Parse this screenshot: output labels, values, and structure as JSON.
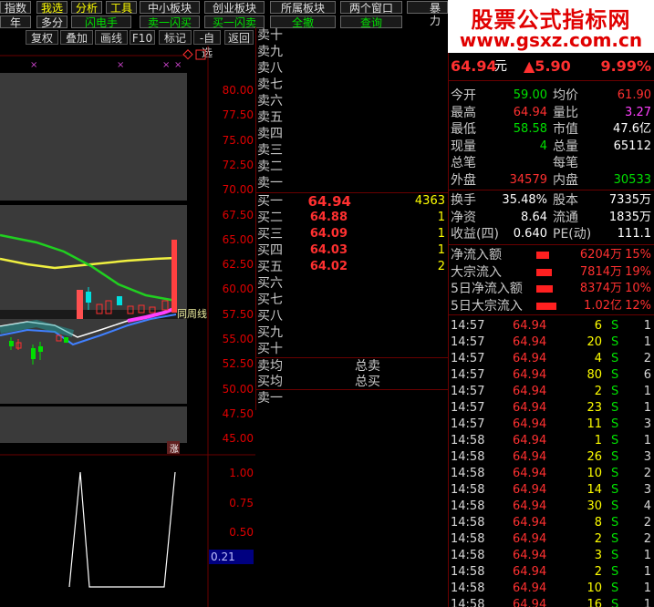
{
  "menu_top": [
    {
      "label": "指数",
      "style": "normal"
    },
    {
      "label": "我选",
      "style": "sel"
    },
    {
      "label": "分析",
      "style": "sel"
    },
    {
      "label": "工具",
      "style": "sel"
    },
    {
      "label": "中小板块",
      "style": "normal"
    },
    {
      "label": "创业板块",
      "style": "normal"
    },
    {
      "label": "所属板块",
      "style": "normal"
    },
    {
      "label": "两个窗口",
      "style": "normal"
    },
    {
      "label": "暴力",
      "style": "normal"
    }
  ],
  "menu_second": [
    {
      "label": "年",
      "style": "normal"
    },
    {
      "label": "多分",
      "style": "normal"
    },
    {
      "label": "闪电手",
      "style": "green"
    },
    {
      "label": "卖一闪买",
      "style": "green"
    },
    {
      "label": "买一闪卖",
      "style": "green"
    },
    {
      "label": "全撤",
      "style": "green"
    },
    {
      "label": "查询",
      "style": "green"
    }
  ],
  "toolbar": [
    "复权",
    "叠加",
    "画线",
    "F10",
    "标记",
    "-自选",
    "返回"
  ],
  "watermark": {
    "line1": "股票公式指标网",
    "line2": "www.gsxz.com.cn"
  },
  "chart": {
    "y_ticks": [
      "80.00",
      "77.50",
      "75.00",
      "72.50",
      "70.00",
      "67.50",
      "65.00",
      "62.50",
      "60.00",
      "57.50",
      "55.00",
      "52.50",
      "50.00",
      "47.50",
      "45.00"
    ],
    "annotation": "同周线",
    "marker_label": "涨",
    "indicator_ticks": [
      "1.00",
      "0.75",
      "0.50"
    ],
    "indicator_value": "0.21"
  },
  "orderbook": {
    "sell_labels": [
      "卖十",
      "卖九",
      "卖八",
      "卖七",
      "卖六",
      "卖五",
      "卖四",
      "卖三",
      "卖二",
      "卖一"
    ],
    "buy": [
      {
        "label": "买一",
        "price": "64.94",
        "vol": "4363"
      },
      {
        "label": "买二",
        "price": "64.88",
        "vol": "1"
      },
      {
        "label": "买三",
        "price": "64.09",
        "vol": "1"
      },
      {
        "label": "买四",
        "price": "64.03",
        "vol": "1"
      },
      {
        "label": "买五",
        "price": "64.02",
        "vol": "2"
      },
      {
        "label": "买六",
        "price": "",
        "vol": ""
      },
      {
        "label": "买七",
        "price": "",
        "vol": ""
      },
      {
        "label": "买八",
        "price": "",
        "vol": ""
      },
      {
        "label": "买九",
        "price": "",
        "vol": ""
      },
      {
        "label": "买十",
        "price": "",
        "vol": ""
      }
    ],
    "sell_avg": "卖均",
    "buy_avg": "买均",
    "total_sell": "总卖",
    "total_buy": "总买",
    "bottom_label": "卖一"
  },
  "quote": {
    "price": "64.94",
    "unit": "元",
    "change": "▲5.90",
    "pct": "9.99%",
    "rows": [
      {
        "l1": "今开",
        "v1": "59.00",
        "c1": "green",
        "l2": "均价",
        "v2": "61.90",
        "c2": "red"
      },
      {
        "l1": "最高",
        "v1": "64.94",
        "c1": "red",
        "l2": "量比",
        "v2": "3.27",
        "c2": "magenta"
      },
      {
        "l1": "最低",
        "v1": "58.58",
        "c1": "green",
        "l2": "市值",
        "v2": "47.6亿",
        "c2": "white"
      },
      {
        "l1": "现量",
        "v1": "4",
        "c1": "green",
        "l2": "总量",
        "v2": "65112",
        "c2": "white"
      },
      {
        "l1": "总笔",
        "v1": "",
        "c1": "white",
        "l2": "每笔",
        "v2": "",
        "c2": "white"
      },
      {
        "l1": "外盘",
        "v1": "34579",
        "c1": "red",
        "l2": "内盘",
        "v2": "30533",
        "c2": "green"
      }
    ],
    "rows2": [
      {
        "l1": "换手",
        "v1": "35.48%",
        "l2": "股本",
        "v2": "7335万"
      },
      {
        "l1": "净资",
        "v1": "8.64",
        "l2": "流通",
        "v2": "1835万"
      },
      {
        "l1": "收益(四)",
        "v1": "0.640",
        "l2": "PE(动)",
        "v2": "111.1"
      }
    ],
    "flows": [
      {
        "label": "净流入额",
        "value": "6204万",
        "pct": "15%"
      },
      {
        "label": "大宗流入",
        "value": "7814万",
        "pct": "19%"
      },
      {
        "label": "5日净流入额",
        "value": "8374万",
        "pct": "10%"
      },
      {
        "label": "5日大宗流入",
        "value": "1.02亿",
        "pct": "12%"
      }
    ]
  },
  "trades": [
    {
      "time": "14:57",
      "price": "64.94",
      "vol": "6",
      "side": "S",
      "n": "1"
    },
    {
      "time": "14:57",
      "price": "64.94",
      "vol": "20",
      "side": "S",
      "n": "1"
    },
    {
      "time": "14:57",
      "price": "64.94",
      "vol": "4",
      "side": "S",
      "n": "2"
    },
    {
      "time": "14:57",
      "price": "64.94",
      "vol": "80",
      "side": "S",
      "n": "6"
    },
    {
      "time": "14:57",
      "price": "64.94",
      "vol": "2",
      "side": "S",
      "n": "1"
    },
    {
      "time": "14:57",
      "price": "64.94",
      "vol": "23",
      "side": "S",
      "n": "1"
    },
    {
      "time": "14:57",
      "price": "64.94",
      "vol": "11",
      "side": "S",
      "n": "3"
    },
    {
      "time": "14:58",
      "price": "64.94",
      "vol": "1",
      "side": "S",
      "n": "1"
    },
    {
      "time": "14:58",
      "price": "64.94",
      "vol": "26",
      "side": "S",
      "n": "3"
    },
    {
      "time": "14:58",
      "price": "64.94",
      "vol": "10",
      "side": "S",
      "n": "2"
    },
    {
      "time": "14:58",
      "price": "64.94",
      "vol": "14",
      "side": "S",
      "n": "3"
    },
    {
      "time": "14:58",
      "price": "64.94",
      "vol": "30",
      "side": "S",
      "n": "4"
    },
    {
      "time": "14:58",
      "price": "64.94",
      "vol": "8",
      "side": "S",
      "n": "2"
    },
    {
      "time": "14:58",
      "price": "64.94",
      "vol": "2",
      "side": "S",
      "n": "2"
    },
    {
      "time": "14:58",
      "price": "64.94",
      "vol": "3",
      "side": "S",
      "n": "1"
    },
    {
      "time": "14:58",
      "price": "64.94",
      "vol": "2",
      "side": "S",
      "n": "1"
    },
    {
      "time": "14:58",
      "price": "64.94",
      "vol": "10",
      "side": "S",
      "n": "1"
    },
    {
      "time": "14:58",
      "price": "64.94",
      "vol": "16",
      "side": "S",
      "n": "1"
    }
  ],
  "colors": {
    "up": "#ff3030",
    "down": "#00e000",
    "volume": "#ffff00",
    "divider": "#6a0000"
  }
}
